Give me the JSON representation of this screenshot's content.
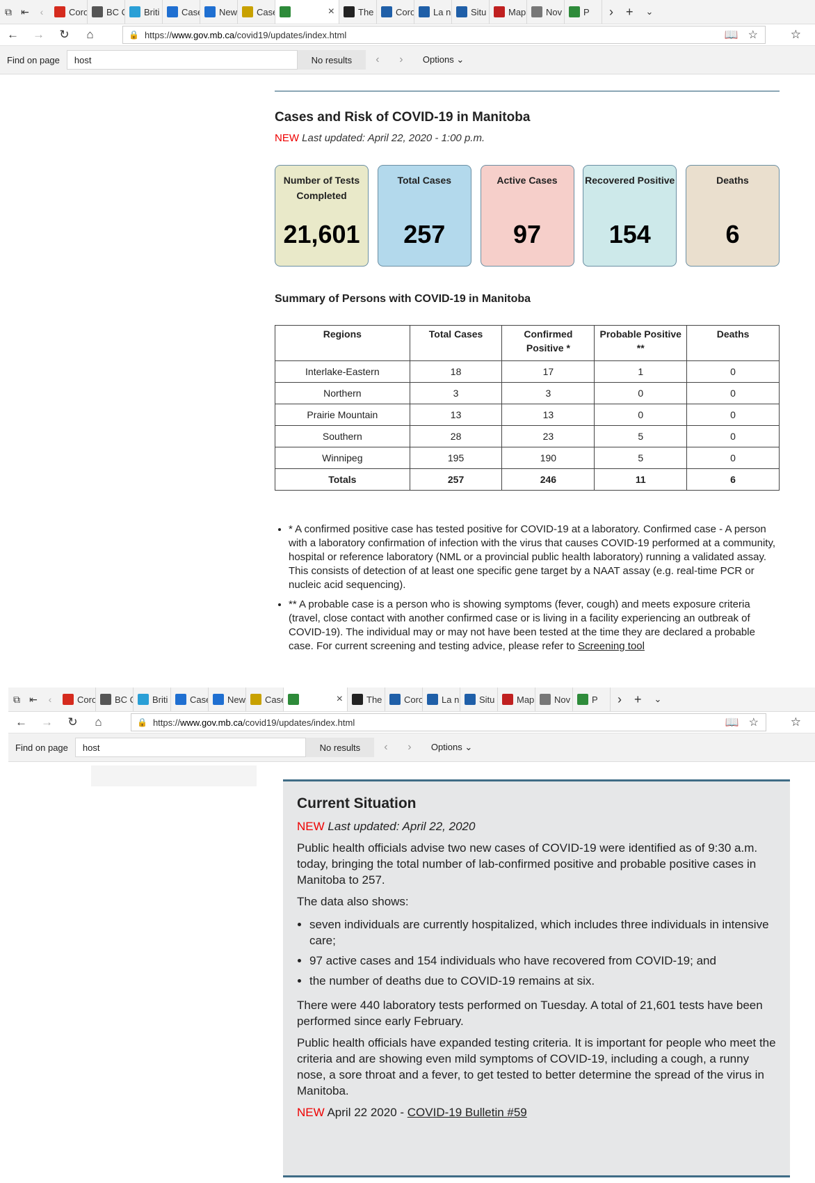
{
  "browser": {
    "tabs": [
      {
        "label": "Coro",
        "icon": "maple-leaf-icon",
        "color": "#d52b1e"
      },
      {
        "label": "BC C",
        "icon": "cbc-icon",
        "color": "#555555"
      },
      {
        "label": "Briti",
        "icon": "bc-icon",
        "color": "#2a9fd6"
      },
      {
        "label": "Case",
        "icon": "chart-icon",
        "color": "#1f6fd1"
      },
      {
        "label": "New",
        "icon": "chart-icon",
        "color": "#1f6fd1"
      },
      {
        "label": "Case",
        "icon": "document-icon",
        "color": "#c8a100"
      },
      {
        "label": "",
        "icon": "green-icon",
        "color": "#2e8b3a",
        "active": true
      },
      {
        "label": "The",
        "icon": "globe-icon",
        "color": "#222222"
      },
      {
        "label": "Coro",
        "icon": "fleur-icon",
        "color": "#1f5fa8"
      },
      {
        "label": "La n",
        "icon": "fleur-icon",
        "color": "#1f5fa8"
      },
      {
        "label": "Situ",
        "icon": "fleur-icon",
        "color": "#1f5fa8"
      },
      {
        "label": "Map",
        "icon": "pdf-icon",
        "color": "#c02020"
      },
      {
        "label": "Nov",
        "icon": "image-icon",
        "color": "#777777"
      },
      {
        "label": "P",
        "icon": "people-icon",
        "color": "#2e8b3a"
      }
    ],
    "url_prefix": "https://",
    "url_host": "www.gov.mb.ca",
    "url_path": "/covid19/updates/index.html",
    "find": {
      "label": "Find on page",
      "query": "host",
      "result": "No results",
      "options": "Options"
    }
  },
  "page1": {
    "title": "Cases and Risk of COVID-19 in Manitoba",
    "new_tag": "NEW",
    "updated": "Last updated: April 22, 2020 - 1:00 p.m.",
    "cards": [
      {
        "label": "Number of Tests Completed",
        "value": "21,601",
        "bg": "#e9e9c9"
      },
      {
        "label": "Total Cases",
        "value": "257",
        "bg": "#b3d9ec"
      },
      {
        "label": "Active Cases",
        "value": "97",
        "bg": "#f6cfca"
      },
      {
        "label": "Recovered Positive",
        "value": "154",
        "bg": "#cde9ea"
      },
      {
        "label": "Deaths",
        "value": "6",
        "bg": "#eadfce"
      }
    ],
    "summary_title": "Summary of Persons with COVID-19 in Manitoba",
    "table": {
      "headers": [
        "Regions",
        "Total Cases",
        "Confirmed Positive *",
        "Probable Positive **",
        "Deaths"
      ],
      "rows": [
        [
          "Interlake-Eastern",
          "18",
          "17",
          "1",
          "0"
        ],
        [
          "Northern",
          "3",
          "3",
          "0",
          "0"
        ],
        [
          "Prairie Mountain",
          "13",
          "13",
          "0",
          "0"
        ],
        [
          "Southern",
          "28",
          "23",
          "5",
          "0"
        ],
        [
          "Winnipeg",
          "195",
          "190",
          "5",
          "0"
        ]
      ],
      "totals": [
        "Totals",
        "257",
        "246",
        "11",
        "6"
      ]
    },
    "note1": "* A confirmed positive case has tested positive for COVID-19 at a laboratory. Confirmed case - A person with a laboratory confirmation of infection with the virus that causes COVID-19 performed at a community, hospital or reference laboratory (NML or a provincial public health laboratory) running a validated assay. This consists of detection of at least one specific gene target by a NAAT assay (e.g. real-time PCR or nucleic acid sequencing).",
    "note2": "** A probable case is a person who is showing symptoms (fever, cough) and meets exposure criteria (travel, close contact with another confirmed case or is living in a facility experiencing an outbreak of COVID-19). The individual may or may not have been tested at the time they are declared a probable case. For current screening and testing advice, please refer to",
    "note2_link": "Screening tool"
  },
  "page2": {
    "title": "Current Situation",
    "new_tag": "NEW",
    "updated": "Last updated: April 22, 2020",
    "para1": "Public health officials advise two new cases of COVID-19 were identified as of 9:30 a.m. today, bringing the total number of lab-confirmed positive and probable positive cases in Manitoba to 257.",
    "para2": "The data also shows:",
    "bullets": [
      "seven individuals are currently hospitalized, which includes three individuals in intensive care;",
      "97 active cases and 154 individuals who have recovered from COVID-19; and",
      "the number of deaths due to COVID-19 remains at six."
    ],
    "para3": "There were 440 laboratory tests performed on Tuesday. A total of 21,601 tests have been performed since early February.",
    "para4": "Public health officials have expanded testing criteria. It is important for people who meet the criteria and are showing even mild symptoms of COVID-19, including a cough, a runny nose, a sore throat and a fever, to get tested to better determine the spread of the virus in Manitoba.",
    "bulletin_date": "April 22 2020 -",
    "bulletin_link": "COVID-19 Bulletin #59"
  }
}
